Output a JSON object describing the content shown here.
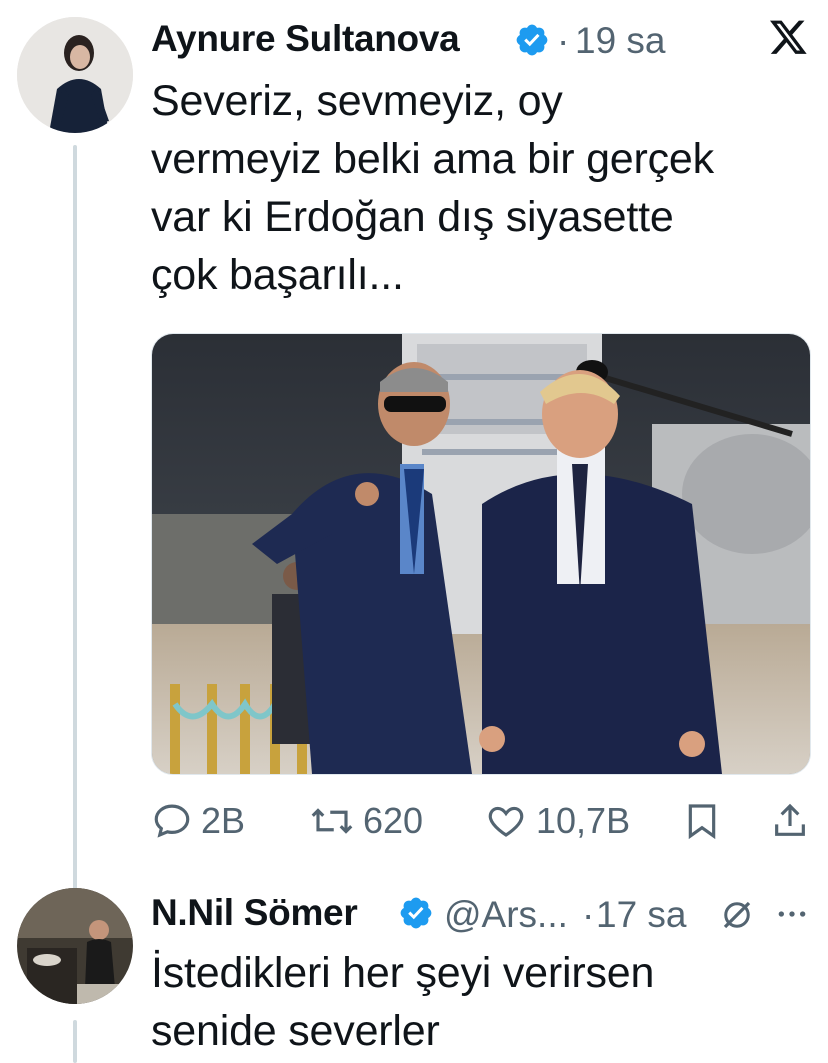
{
  "tweet1": {
    "author": "Aynure Sultanova",
    "separator": "·",
    "time": "19 sa",
    "text_lines": [
      "Severiz, sevmeyiz, oy",
      "vermeyiz belki ama bir gerçek",
      "var ki Erdoğan dış siyasette",
      "çok başarılı..."
    ],
    "media_description_icon": "photo",
    "actions": {
      "replies": "2B",
      "retweets": "620",
      "likes": "10,7B"
    }
  },
  "tweet2": {
    "author": "N.Nil Sömer",
    "handle": "@Ars...",
    "separator": "·",
    "time": "17 sa",
    "text_lines": [
      "İstedikleri her şeyi verirsen",
      "senide severler"
    ]
  },
  "colors": {
    "verified": "#1d9bf0",
    "muted": "#536471",
    "thread_line": "#cfd9de",
    "text": "#0f1419"
  },
  "icons": [
    "x-logo-icon",
    "verified-badge-icon",
    "reply-icon",
    "retweet-icon",
    "like-icon",
    "bookmark-icon",
    "share-icon",
    "grok-icon",
    "more-icon"
  ]
}
